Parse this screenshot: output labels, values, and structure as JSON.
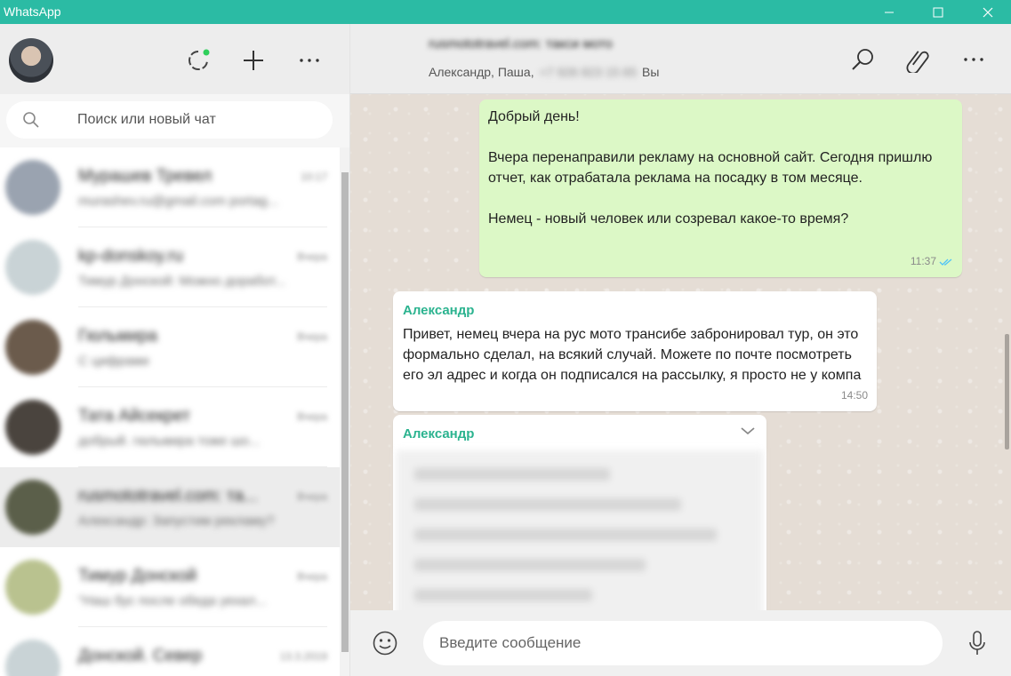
{
  "window": {
    "title": "WhatsApp",
    "controls": [
      "minimize-icon",
      "maximize-icon",
      "close-icon"
    ]
  },
  "sidebar": {
    "header_icons": [
      "status-icon",
      "new-chat-icon",
      "more-options-icon"
    ],
    "search": {
      "placeholder": "Поиск или новый чат"
    },
    "chats": [
      {
        "name": "Мурашев Тревел",
        "time": "10:17",
        "preview": "murashev.ru@gmail.com portag...",
        "avatar_color": "#9aa3b0"
      },
      {
        "name": "kp-donskoy.ru",
        "time": "Вчера",
        "preview": "Тимур Донской: Можно доработ...",
        "avatar_color": "#c9d3d6"
      },
      {
        "name": "Гюльмира",
        "time": "Вчера",
        "preview": "С цифрами",
        "avatar_color": "#6b5b4c"
      },
      {
        "name": "Тата Айсекрет",
        "time": "Вчера",
        "preview": "добрый. гюльмира тоже шо...",
        "avatar_color": "#4a443e"
      },
      {
        "name": "rusmototravel.com: та...",
        "time": "Вчера",
        "preview": "Александр: Запустим рекламу?",
        "avatar_color": "#5b5f4a",
        "active": true
      },
      {
        "name": "Тимур Донской",
        "time": "Вчера",
        "preview": "\"Наш бус после обеда уехал...",
        "avatar_color": "#b9c28f"
      },
      {
        "name": "Донской. Север",
        "time": "13.3.2019",
        "preview": "",
        "avatar_color": "#c9d3d6"
      }
    ]
  },
  "conversation": {
    "title": "rusmototravel.com: такси мото тур",
    "participants": {
      "names": "Александр, Паша,",
      "hidden_phone": "+7 926 823 15 65",
      "self": "Вы"
    },
    "header_icons": [
      "search-icon",
      "attach-icon",
      "more-options-icon"
    ],
    "messages": [
      {
        "direction": "out",
        "text": "Добрый день!\n\nВчера перенаправили рекламу на основной сайт. Сегодня пришлю отчет, как отрабатала реклама на посадку в том месяце.\n\nНемец - новый человек или созревал какое-то время?",
        "time": "11:37",
        "status": "read"
      },
      {
        "direction": "in",
        "sender": "Александр",
        "text": "Привет, немец вчера на рус мото трансибе забронировал тур, он это формально сделал, на всякий случай. Можете по почте посмотреть его эл адрес и когда он подписался на рассылку, я просто не у компа",
        "time": "14:50"
      },
      {
        "direction": "in",
        "sender": "Александр",
        "type": "image",
        "blurred": true
      }
    ],
    "composer": {
      "placeholder": "Введите сообщение"
    }
  },
  "colors": {
    "titlebar": "#2bbba4",
    "outgoing_bubble": "#dcf8c6",
    "incoming_bubble": "#ffffff",
    "sender_name": "#2bb38f",
    "read_ticks": "#4fc3f7",
    "chat_background": "#e5ddd5"
  }
}
